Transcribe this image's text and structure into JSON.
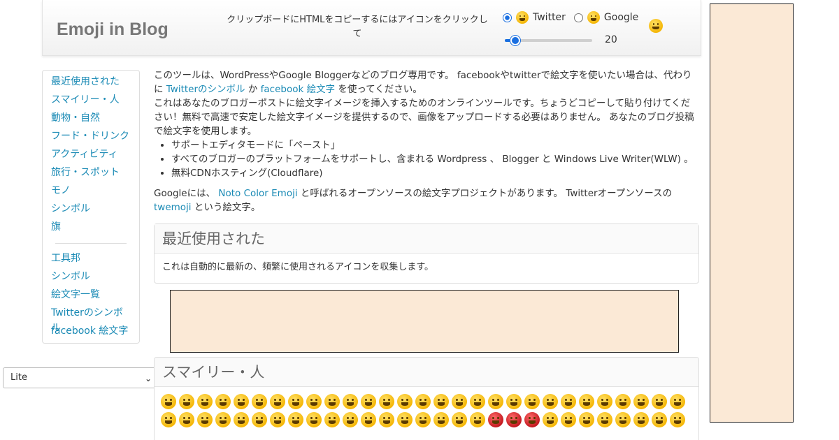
{
  "header": {
    "brand": "Emoji in Blog",
    "hint": "クリップボードにHTMLをコピーするにはアイコンをクリックして",
    "radio_twitter": "Twitter",
    "radio_google": "Google",
    "selected_style": "Twitter",
    "slider_value": "20"
  },
  "sidebar": {
    "group1": [
      "最近使用された",
      "スマイリー・人",
      "動物・自然",
      "フード・ドリンク",
      "アクティビティ",
      "旅行・スポット",
      "モノ",
      "シンボル",
      "旗"
    ],
    "group2": [
      "工具邦",
      "シンボル",
      "絵文字一覧",
      "Twitterのシンボル",
      "facebook 絵文字"
    ]
  },
  "lite_select": {
    "value": "Lite"
  },
  "intro": {
    "p1_a": "このツールは、WordPressやGoogle Bloggerなどのブログ専用です。 facebookやtwitterで絵文字を使いたい場合は、代わりに ",
    "p1_link1": "Twitterのシンボル",
    "p1_b": " か ",
    "p1_link2": "facebook 絵文字",
    "p1_c": " を使ってください。",
    "p2": "これはあなたのブロガーポストに絵文字イメージを挿入するためのオンラインツールです。ちょうどコピーして貼り付けてください！無料で高速で安定した絵文字イメージを提供するので、画像をアップロードする必要はありません。 あなたのブログ投稿で絵文字を使用します。",
    "bullets": [
      "サポートエディタモードに「ペースト」",
      "すべてのブロガーのプラットフォームをサポートし、含まれる Wordpress 、 Blogger と Windows Live Writer(WLW) 。",
      "無料CDNホスティング(Cloudflare)"
    ],
    "p3_a": "Googleには、 ",
    "p3_link1": "Noto Color Emoji",
    "p3_b": " と呼ばれるオープンソースの絵文字プロジェクトがあります。 Twitterオープンソースの ",
    "p3_link2": "twemoji",
    "p3_c": " という絵文字。"
  },
  "recent_panel": {
    "title": "最近使用された",
    "body": "これは自動的に最新の、頻繁に使用されるアイコンを収集します。"
  },
  "smiley_panel": {
    "title": "スマイリー・人",
    "emoji_icons": [
      "grinning-face-icon",
      "grimacing-face-icon",
      "beaming-face-icon",
      "tears-of-joy-icon",
      "smiley-icon",
      "grinning-smiling-eyes-icon",
      "rolling-laughing-icon",
      "sweat-smile-icon",
      "laughing-icon",
      "innocent-icon",
      "wink-icon",
      "blush-icon",
      "slightly-smiling-icon",
      "upside-down-icon",
      "relaxed-icon",
      "yum-icon",
      "relieved-icon",
      "heart-eyes-icon",
      "kissing-heart-icon",
      "kissing-icon",
      "kissing-smiling-eyes-icon",
      "kissing-closed-eyes-icon",
      "zany-icon",
      "stuck-out-tongue-wink-icon",
      "stuck-out-tongue-closed-icon",
      "stuck-out-tongue-icon",
      "money-mouth-icon",
      "sunglasses-icon",
      "nerd-icon",
      "monocle-icon",
      "cowboy-icon",
      "hugging-icon",
      "clown-icon",
      "smirk-icon",
      "no-mouth-icon",
      "neutral-icon",
      "expressionless-icon",
      "unamused-icon",
      "rolling-eyes-icon",
      "raised-eyebrow-icon",
      "thinking-icon",
      "shushing-icon",
      "hand-over-mouth-icon",
      "lying-icon",
      "flushed-icon",
      "disappointed-icon",
      "worried-icon",
      "angry-icon",
      "pouting-icon",
      "cursing-icon",
      "pensive-icon",
      "confused-icon",
      "slightly-frowning-icon",
      "frowning-icon",
      "persevere-icon",
      "confounded-icon",
      "tired-icon",
      "weary-icon"
    ]
  }
}
